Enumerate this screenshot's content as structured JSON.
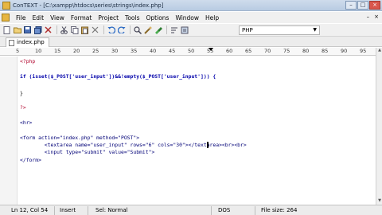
{
  "window": {
    "title": "ConTEXT - [C:\\xampp\\htdocs\\series\\strings\\index.php]",
    "controls": [
      "–",
      "□",
      "×"
    ],
    "app_icon": "context-icon"
  },
  "menu": {
    "items": [
      "File",
      "Edit",
      "View",
      "Format",
      "Project",
      "Tools",
      "Options",
      "Window",
      "Help"
    ],
    "right": [
      "–",
      "×"
    ]
  },
  "toolbar": {
    "icons": [
      "new-file-icon",
      "open-file-icon",
      "save-icon",
      "save-all-icon",
      "close-icon",
      "cut-icon",
      "copy-icon",
      "paste-icon",
      "delete-icon",
      "undo-icon",
      "redo-icon",
      "find-icon",
      "replace-icon",
      "highlight-icon",
      "wordwrap-icon",
      "settings-icon"
    ],
    "language": "PHP"
  },
  "tabs": [
    {
      "label": "index.php"
    }
  ],
  "ruler": {
    "numbers": [
      "5",
      "10",
      "15",
      "20",
      "25",
      "30",
      "35",
      "40",
      "45",
      "50",
      "55",
      "60",
      "65",
      "70",
      "75",
      "80",
      "85",
      "90",
      "95"
    ]
  },
  "code": {
    "lines": [
      "<?php",
      "",
      "if (isset($_POST['user_input'])&&!empty($_POST['user_input'])) {",
      "",
      "}",
      "",
      "?>",
      "",
      "<hr>",
      "",
      "<form action=\"index.php\" method=\"POST\">",
      "        <textarea name=\"user_input\" rows=\"6\" cols=\"30\"></textarea><br><br>",
      "        <input type=\"submit\" value=\"Submit\">",
      "</form>"
    ]
  },
  "status": {
    "position": "Ln 12, Col 54",
    "mode": "Insert",
    "selection": "Sel: Normal",
    "line_ending": "DOS",
    "file_size": "File size: 264"
  }
}
